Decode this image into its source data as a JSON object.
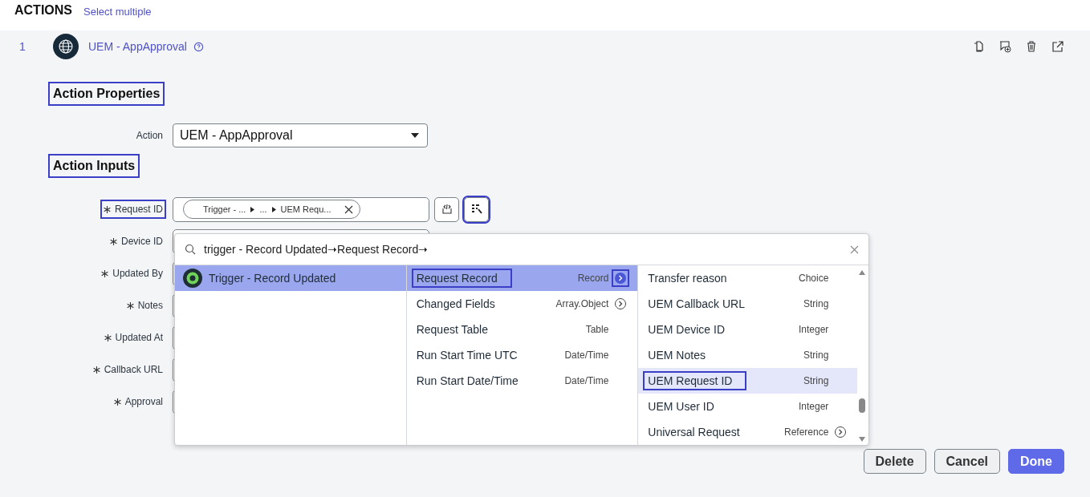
{
  "header": {
    "title": "ACTIONS",
    "link": "Select multiple"
  },
  "action": {
    "number": "1",
    "title": "UEM - AppApproval"
  },
  "properties": {
    "heading": "Action Properties",
    "highlighted": true,
    "label": "Action",
    "value": "UEM - AppApproval"
  },
  "inputs": {
    "heading": "Action Inputs",
    "highlighted": true,
    "fields": [
      {
        "label": "Request ID",
        "required": true,
        "highlighted": true,
        "pill": [
          "Trigger - ...",
          "...",
          "UEM Requ..."
        ]
      },
      {
        "label": "Device ID",
        "required": true,
        "highlighted": false
      },
      {
        "label": "Updated By",
        "required": true,
        "highlighted": false
      },
      {
        "label": "Notes",
        "required": true,
        "highlighted": false
      },
      {
        "label": "Updated At",
        "required": true,
        "highlighted": false
      },
      {
        "label": "Callback URL",
        "required": true,
        "highlighted": false
      },
      {
        "label": "Approval",
        "required": true,
        "highlighted": false
      }
    ]
  },
  "picker_button": {
    "highlighted": true
  },
  "picker": {
    "search": "trigger - Record Updated➝Request Record➝",
    "sources": [
      {
        "name": "Trigger - Record Updated",
        "selected": true
      }
    ],
    "pills": [
      {
        "name": "Request Record",
        "type": "Record",
        "has_children": true,
        "selected": true,
        "highlighted": true
      },
      {
        "name": "Changed Fields",
        "type": "Array.Object",
        "has_children": true,
        "selected": false,
        "highlighted": false
      },
      {
        "name": "Request Table",
        "type": "Table",
        "has_children": false,
        "selected": false,
        "highlighted": false
      },
      {
        "name": "Run Start Time UTC",
        "type": "Date/Time",
        "has_children": false,
        "selected": false,
        "highlighted": false
      },
      {
        "name": "Run Start Date/Time",
        "type": "Date/Time",
        "has_children": false,
        "selected": false,
        "highlighted": false
      }
    ],
    "fields": [
      {
        "name": "Transfer reason",
        "type": "Choice",
        "has_children": false,
        "selected": false,
        "highlighted": false
      },
      {
        "name": "UEM Callback URL",
        "type": "String",
        "has_children": false,
        "selected": false,
        "highlighted": false
      },
      {
        "name": "UEM Device ID",
        "type": "Integer",
        "has_children": false,
        "selected": false,
        "highlighted": false
      },
      {
        "name": "UEM Notes",
        "type": "String",
        "has_children": false,
        "selected": false,
        "highlighted": false
      },
      {
        "name": "UEM Request ID",
        "type": "String",
        "has_children": false,
        "selected": true,
        "highlighted": true
      },
      {
        "name": "UEM User ID",
        "type": "Integer",
        "has_children": false,
        "selected": false,
        "highlighted": false
      },
      {
        "name": "Universal Request",
        "type": "Reference",
        "has_children": true,
        "selected": false,
        "highlighted": false
      }
    ]
  },
  "buttons": [
    {
      "label": "Delete",
      "kind": "secondary"
    },
    {
      "label": "Cancel",
      "kind": "secondary"
    },
    {
      "label": "Done",
      "kind": "primary"
    }
  ]
}
